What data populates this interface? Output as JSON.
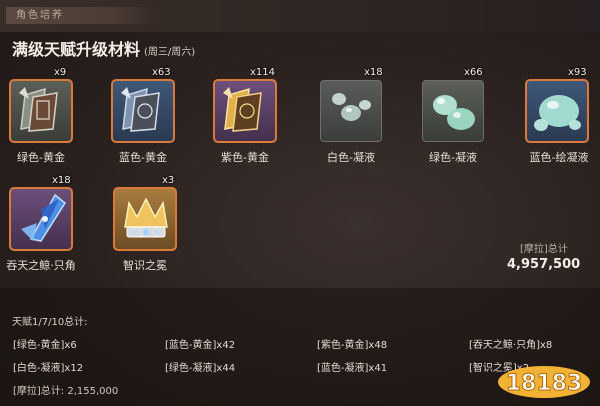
{
  "header": {
    "tag": "角色培养"
  },
  "title": {
    "main": "满级天赋升级材料",
    "sub": "(周三/周六)"
  },
  "materials": [
    {
      "label": "绿色-黄金",
      "qty": "x9",
      "rarity": "green",
      "icon": "book-icon"
    },
    {
      "label": "蓝色-黄金",
      "qty": "x63",
      "rarity": "blue",
      "icon": "book-icon"
    },
    {
      "label": "紫色-黄金",
      "qty": "x114",
      "rarity": "purple",
      "icon": "golden-book-icon"
    },
    {
      "label": "白色-凝液",
      "qty": "x18",
      "rarity": "white",
      "icon": "slime-drop-icon"
    },
    {
      "label": "绿色-凝液",
      "qty": "x66",
      "rarity": "green",
      "icon": "slime-drop-icon"
    },
    {
      "label": "蓝色-绘凝液",
      "qty": "x93",
      "rarity": "blue",
      "icon": "slime-drop-icon"
    },
    {
      "label": "吞天之鲸·只角",
      "qty": "x18",
      "rarity": "purple",
      "icon": "whale-horn-icon"
    },
    {
      "label": "智识之冕",
      "qty": "x3",
      "rarity": "gold",
      "icon": "crown-icon"
    }
  ],
  "mora": {
    "label": "[摩拉]总计",
    "total": "4,957,500"
  },
  "summary": {
    "title": "天赋1/7/10总计:",
    "rows": [
      [
        "[绿色-黄金]x6",
        "[蓝色-黄金]x42",
        "[紫色-黄金]x48",
        "[吞天之鲸·只角]x8"
      ],
      [
        "[白色-凝液]x12",
        "[绿色-凝液]x44",
        "[蓝色-凝液]x41",
        "[智识之冕]x2"
      ]
    ],
    "mora": "[摩拉]总计: 2,155,000"
  },
  "watermark": "18183",
  "colors": {
    "accent": "#d97a3a",
    "watermark": "#f2b233"
  }
}
